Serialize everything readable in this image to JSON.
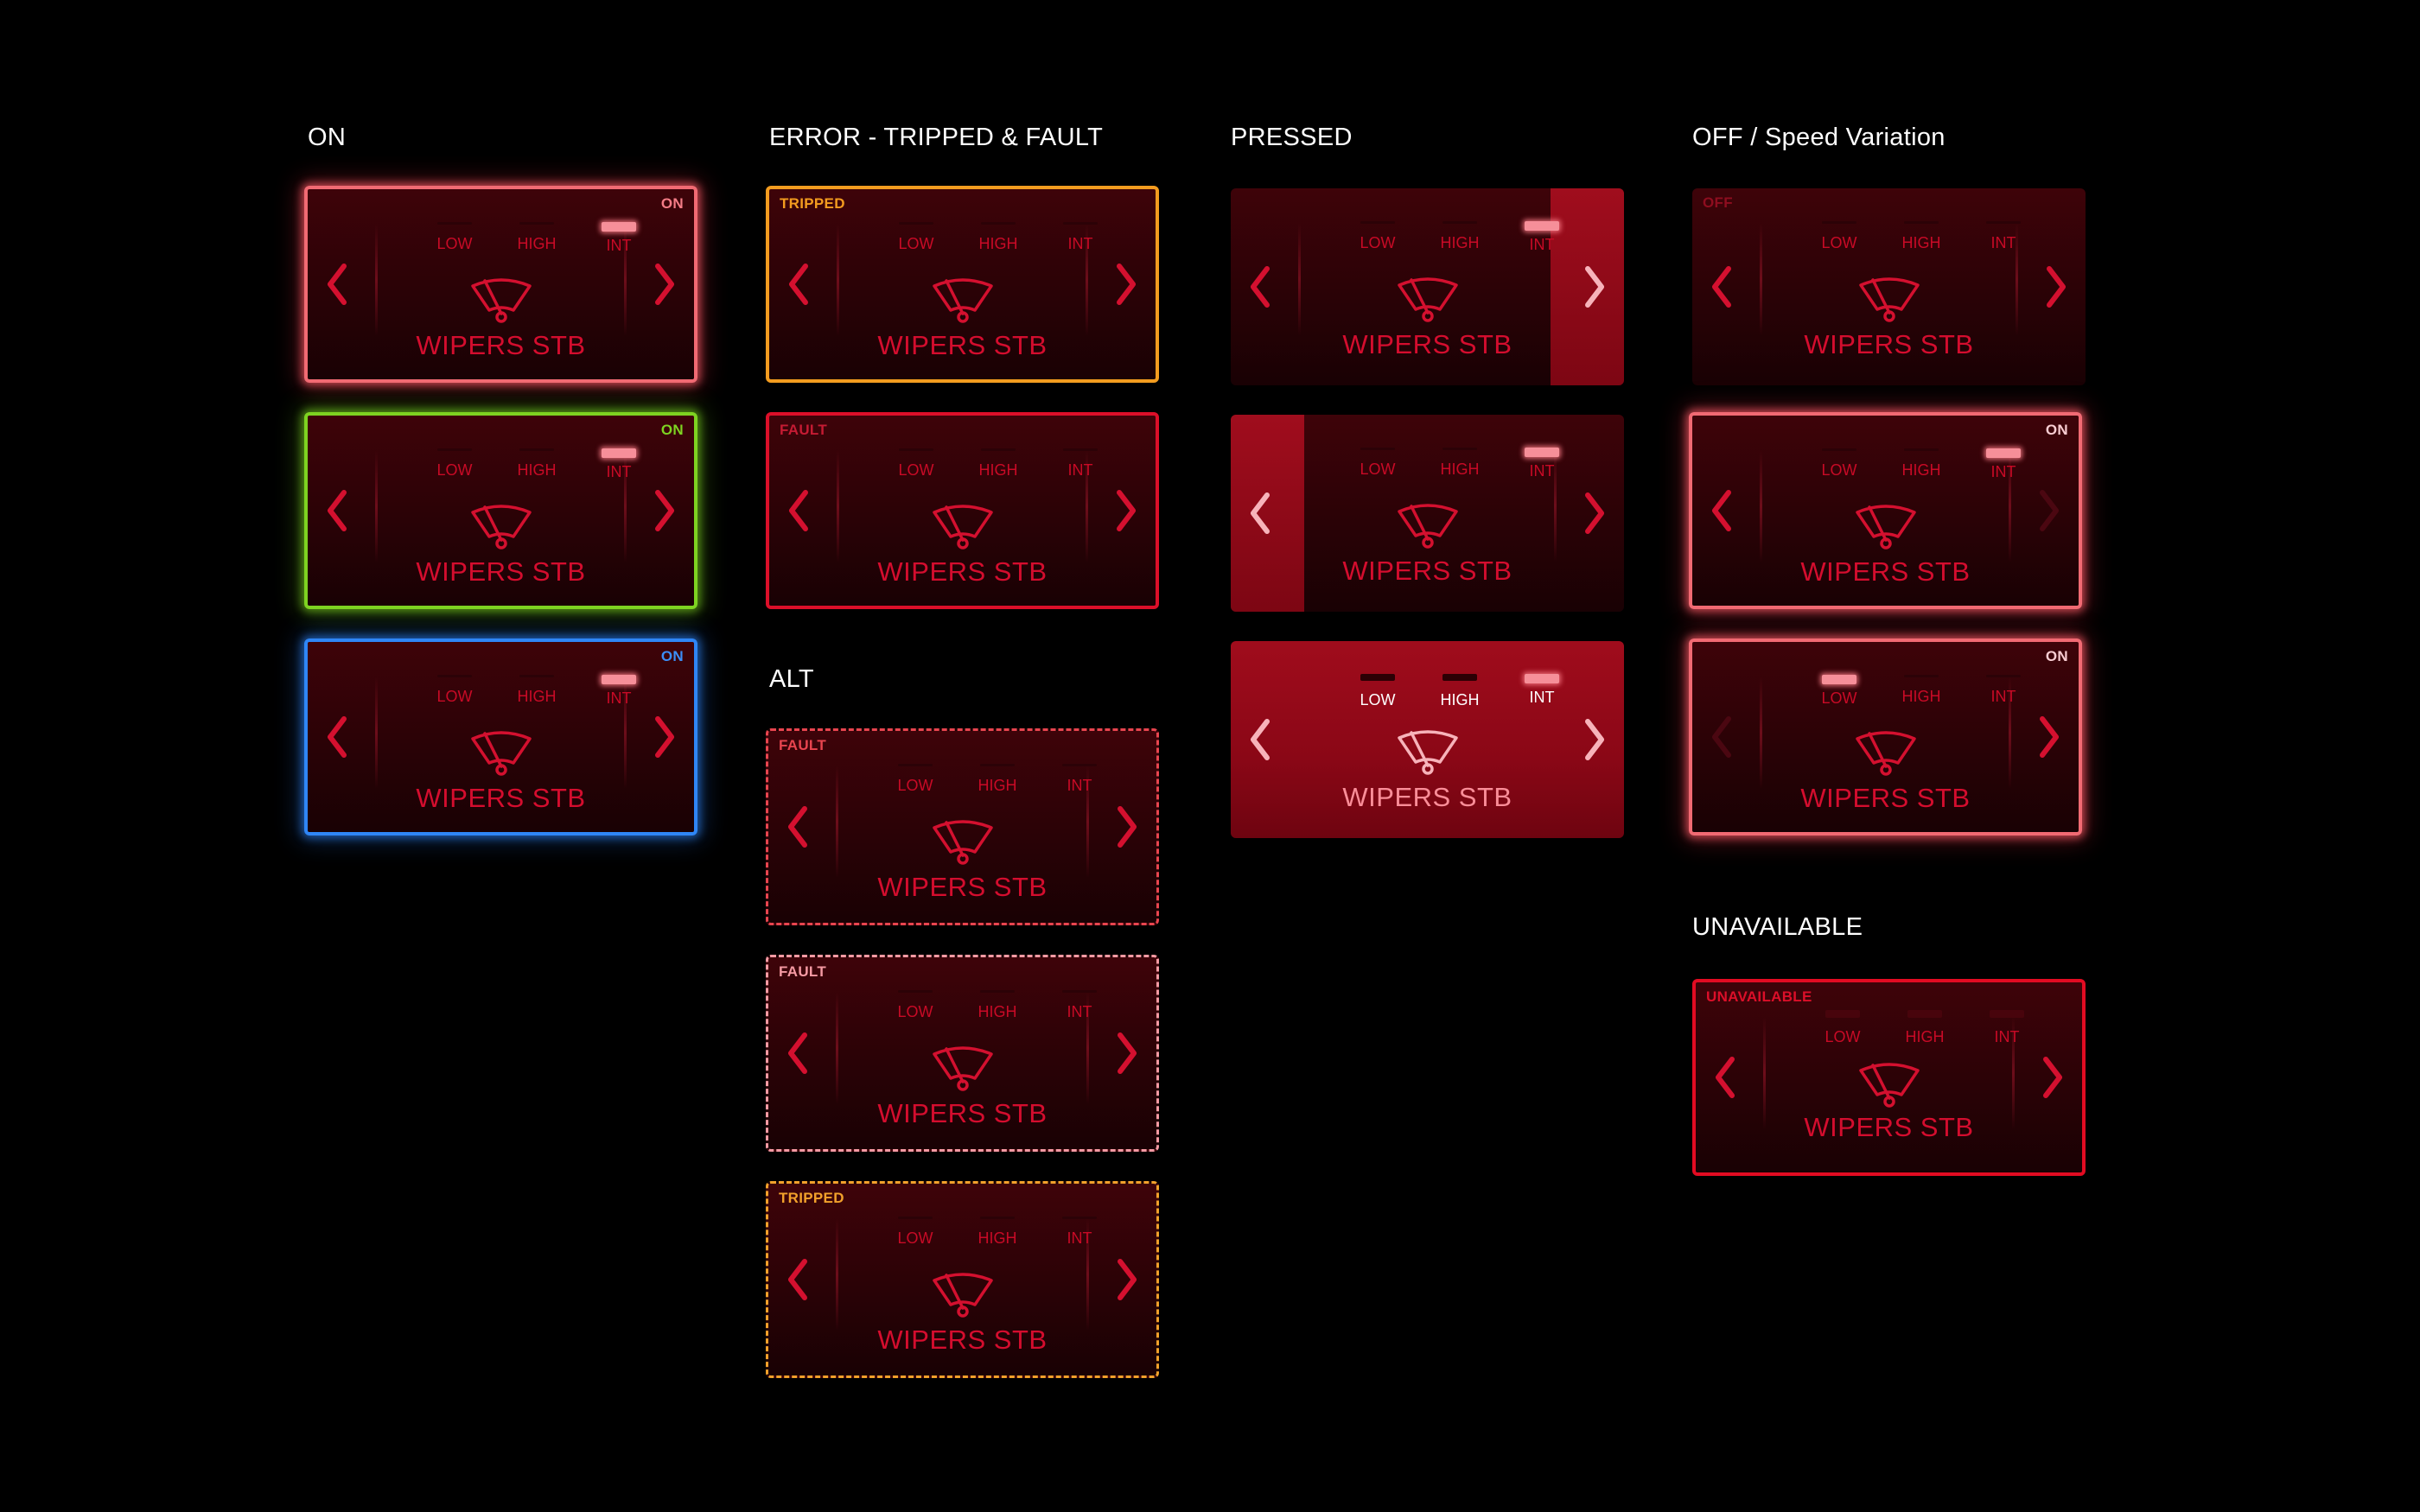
{
  "sections": {
    "on": "ON",
    "error": "ERROR - TRIPPED & FAULT",
    "pressed": "PRESSED",
    "off_speed": "OFF / Speed Variation",
    "alt": "ALT",
    "unavailable": "UNAVAILABLE"
  },
  "widget_label": "WIPERS STB",
  "speeds": [
    "LOW",
    "HIGH",
    "INT"
  ],
  "colors": {
    "bg": "#000000",
    "label_red": "#d40d2e",
    "glow_red": "#f16a73",
    "green": "#7ed321",
    "blue": "#2f86f6",
    "orange": "#f39c1f",
    "fault_red": "#dc0f29",
    "pink": "#f59aa3"
  },
  "icons": {
    "left": "chevron-left-icon",
    "right": "chevron-right-icon",
    "wiper": "windshield-wiper-icon"
  },
  "widgets": [
    {
      "id": "on-red",
      "status": "ON",
      "status_color": "#f47c86",
      "status_pos": "right",
      "active": "INT"
    },
    {
      "id": "on-green",
      "status": "ON",
      "status_color": "#7ed321",
      "status_pos": "right",
      "active": "INT"
    },
    {
      "id": "on-blue",
      "status": "ON",
      "status_color": "#3b8ef7",
      "status_pos": "right",
      "active": "INT"
    },
    {
      "id": "tripped",
      "status": "TRIPPED",
      "status_color": "#f39c1f",
      "status_pos": "left",
      "active": ""
    },
    {
      "id": "fault",
      "status": "FAULT",
      "status_color": "#c51b33",
      "status_pos": "left",
      "active": ""
    },
    {
      "id": "alt-fault-red",
      "status": "FAULT",
      "status_color": "#e8454f",
      "status_pos": "left",
      "active": ""
    },
    {
      "id": "alt-fault-pink",
      "status": "FAULT",
      "status_color": "#f59aa3",
      "status_pos": "left",
      "active": ""
    },
    {
      "id": "alt-tripped",
      "status": "TRIPPED",
      "status_color": "#f2a12b",
      "status_pos": "left",
      "active": ""
    },
    {
      "id": "pressed-right",
      "status": "",
      "status_color": "",
      "status_pos": "left",
      "active": "INT",
      "pressed": "right"
    },
    {
      "id": "pressed-left",
      "status": "",
      "status_color": "",
      "status_pos": "left",
      "active": "INT",
      "pressed": "left"
    },
    {
      "id": "pressed-full",
      "status": "",
      "status_color": "",
      "status_pos": "left",
      "active": "INT",
      "pressed": "full"
    },
    {
      "id": "off",
      "status": "OFF",
      "status_color": "#8e0d1f",
      "status_pos": "left",
      "active": ""
    },
    {
      "id": "speed-max",
      "status": "ON",
      "status_color": "#f9cdd2",
      "status_pos": "right",
      "active": "INT",
      "right_disabled": true
    },
    {
      "id": "speed-min",
      "status": "ON",
      "status_color": "#f9cdd2",
      "status_pos": "right",
      "active": "LOW",
      "left_disabled": true
    },
    {
      "id": "unavailable",
      "status": "UNAVAILABLE",
      "status_color": "#dc0f29",
      "status_pos": "left",
      "active": "",
      "unavailable": true
    }
  ]
}
